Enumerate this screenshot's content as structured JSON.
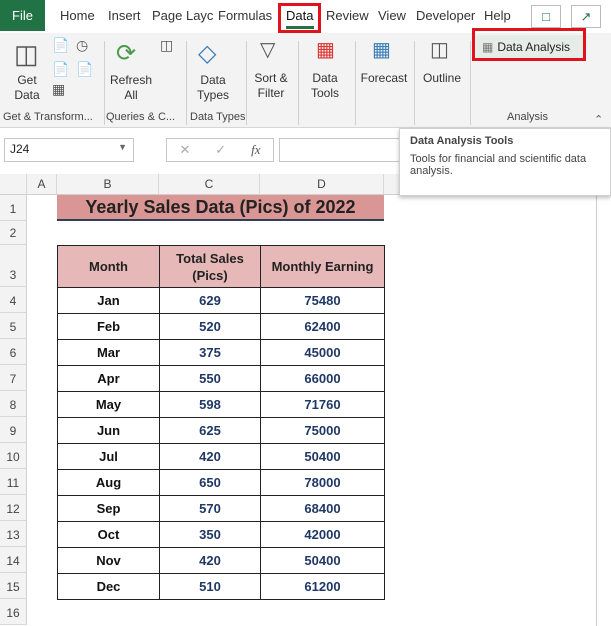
{
  "ribbon_tabs": [
    "File",
    "Home",
    "Insert",
    "Page Layc",
    "Formulas",
    "Data",
    "Review",
    "View",
    "Developer",
    "Help"
  ],
  "active_tab": "Data",
  "ribbon": {
    "get_data": "Get Data",
    "refresh_all": "Refresh All",
    "data_types": "Data Types",
    "sort_filter": "Sort & Filter",
    "data_tools": "Data Tools",
    "forecast": "Forecast",
    "outline": "Outline",
    "data_analysis": "Data Analysis",
    "groups": [
      "Get & Transform...",
      "Queries & C...",
      "Data Types",
      "Analysis"
    ]
  },
  "formula_bar": {
    "name_box": "J24",
    "formula": ""
  },
  "tooltip": {
    "title": "Data Analysis Tools",
    "body": "Tools for financial and scientific data analysis."
  },
  "columns": [
    "A",
    "B",
    "C",
    "D"
  ],
  "rows": [
    "1",
    "2",
    "3",
    "4",
    "5",
    "6",
    "7",
    "8",
    "9",
    "10",
    "11",
    "12",
    "13",
    "14",
    "15",
    "16"
  ],
  "sheet": {
    "title": "Yearly Sales Data (Pics) of 2022",
    "headers": [
      "Month",
      "Total Sales (Pics)",
      "Monthly Earning"
    ],
    "data": [
      [
        "Jan",
        "629",
        "75480"
      ],
      [
        "Feb",
        "520",
        "62400"
      ],
      [
        "Mar",
        "375",
        "45000"
      ],
      [
        "Apr",
        "550",
        "66000"
      ],
      [
        "May",
        "598",
        "71760"
      ],
      [
        "Jun",
        "625",
        "75000"
      ],
      [
        "Jul",
        "420",
        "50400"
      ],
      [
        "Aug",
        "650",
        "78000"
      ],
      [
        "Sep",
        "570",
        "68400"
      ],
      [
        "Oct",
        "350",
        "42000"
      ],
      [
        "Nov",
        "420",
        "50400"
      ],
      [
        "Dec",
        "510",
        "61200"
      ]
    ]
  },
  "colors": {
    "title_fill": "#DA9694",
    "header_fill": "#E6B8B7",
    "value_text": "#203864",
    "accent": "#217346",
    "highlight": "#E0121B"
  }
}
